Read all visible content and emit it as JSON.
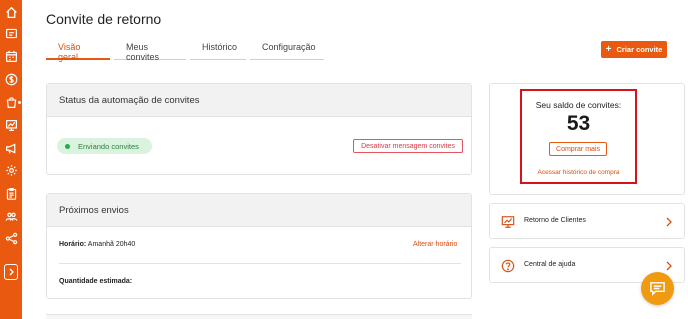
{
  "colors": {
    "brand": "#e9590f",
    "highlight_border": "#d7121b",
    "status_badge_bg": "#d9f3df",
    "chat_fab": "#f09a10"
  },
  "sidebar": {
    "icons": [
      "home-icon",
      "megaphone-icon",
      "calendar-icon",
      "dollar-icon",
      "shopping-bag-icon",
      "presentation-icon",
      "campaign-icon",
      "gear-icon",
      "clipboard-icon",
      "users-icon",
      "share-icon"
    ],
    "expand_icon": "chevron-right-icon"
  },
  "header": {
    "title": "Convite de retorno"
  },
  "tabs": [
    {
      "label": "Visão geral",
      "active": true
    },
    {
      "label": "Meus convites",
      "active": false
    },
    {
      "label": "Histórico",
      "active": false
    },
    {
      "label": "Configuração",
      "active": false
    }
  ],
  "toolbar": {
    "create_label": "Criar convite",
    "create_icon": "plus-icon"
  },
  "status_card": {
    "title": "Status da automação de convites",
    "badge": "Enviando convites",
    "deactivate_label": "Desativar mensagem convites"
  },
  "next_sends": {
    "title": "Próximos envios",
    "time_label": "Horário:",
    "time_value": "Amanhã 20h40",
    "alter_label": "Alterar horário",
    "quantity_label": "Quantidade estimada:"
  },
  "balance": {
    "label": "Seu saldo de convites:",
    "value": "53",
    "buy_label": "Comprar mais",
    "history_link": "Acessar histórico de compra"
  },
  "nav_cards": [
    {
      "label": "Retorno de Clientes",
      "icon": "chart-board-icon"
    },
    {
      "label": "Central de ajuda",
      "icon": "question-circle-icon"
    }
  ],
  "chat": {
    "icon": "chat-icon"
  }
}
